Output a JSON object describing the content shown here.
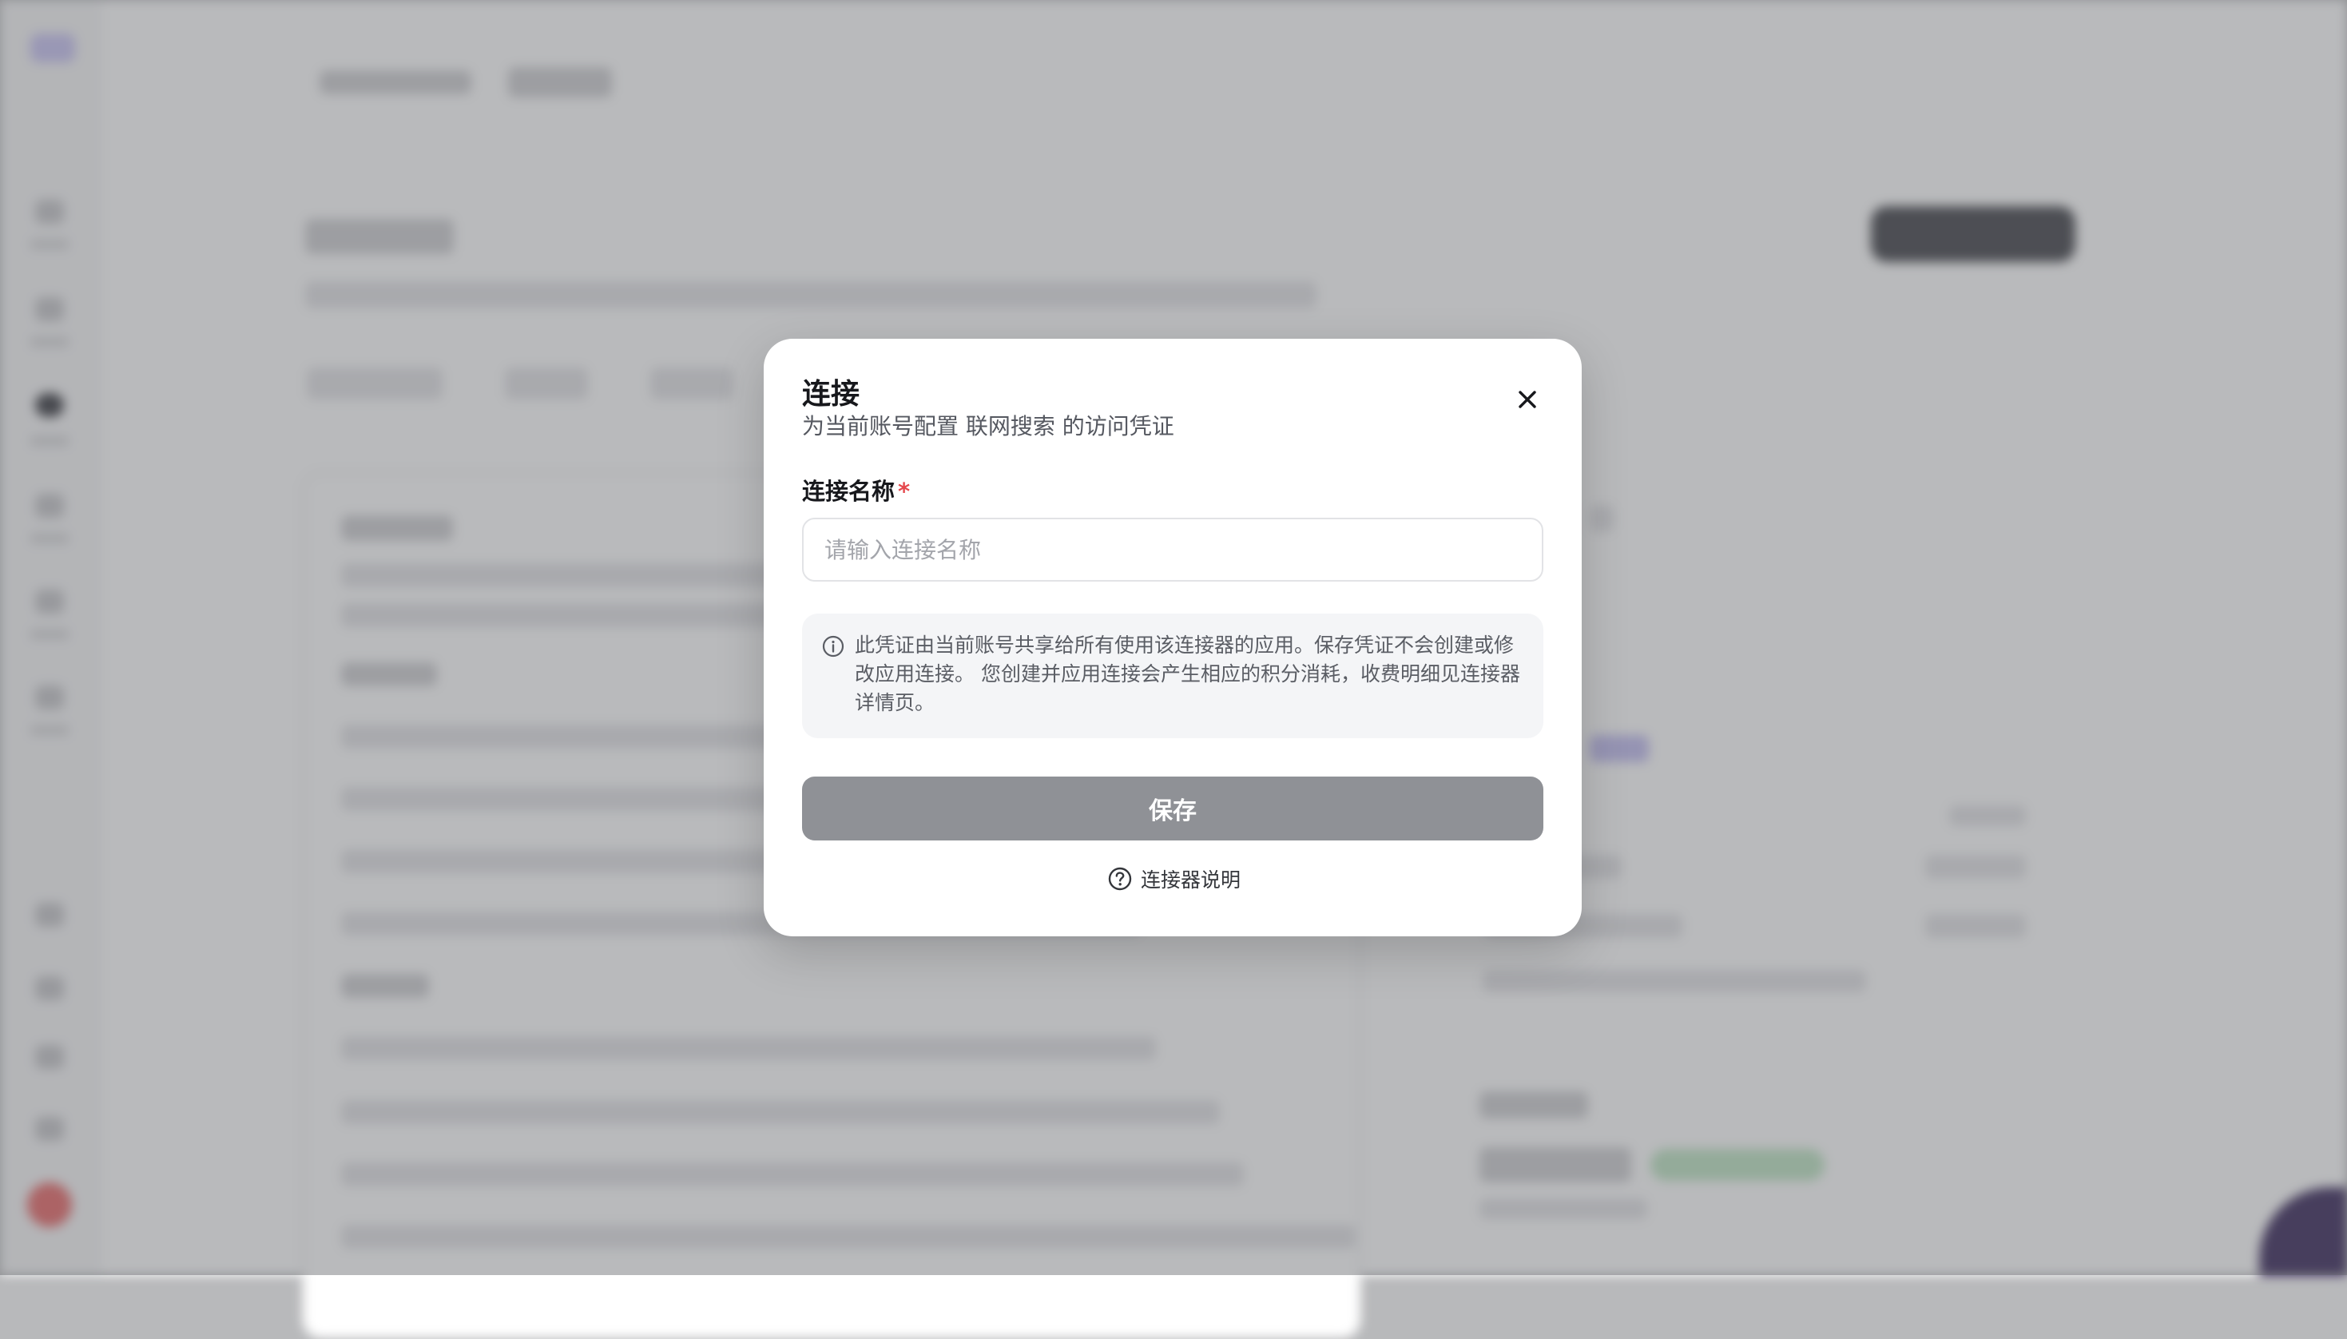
{
  "dialog": {
    "title": "连接",
    "subtitle": "为当前账号配置 联网搜索 的访问凭证",
    "close_icon": "close-icon",
    "field_label": "连接名称",
    "required_mark": "*",
    "name_input": {
      "placeholder": "请输入连接名称",
      "value": ""
    },
    "info_icon": "info-circle-icon",
    "info_text": "此凭证由当前账号共享给所有使用该连接器的应用。保存凭证不会创建或修改应用连接。 您创建并应用连接会产生相应的积分消耗，收费明细见连接器详情页。",
    "save_label": "保存",
    "help_icon": "question-circle-icon",
    "help_label": "连接器说明"
  },
  "colors": {
    "overlay": "#585a60",
    "save_button": "#8f9196",
    "required": "#e5484d",
    "info_background": "#f4f5f7"
  }
}
